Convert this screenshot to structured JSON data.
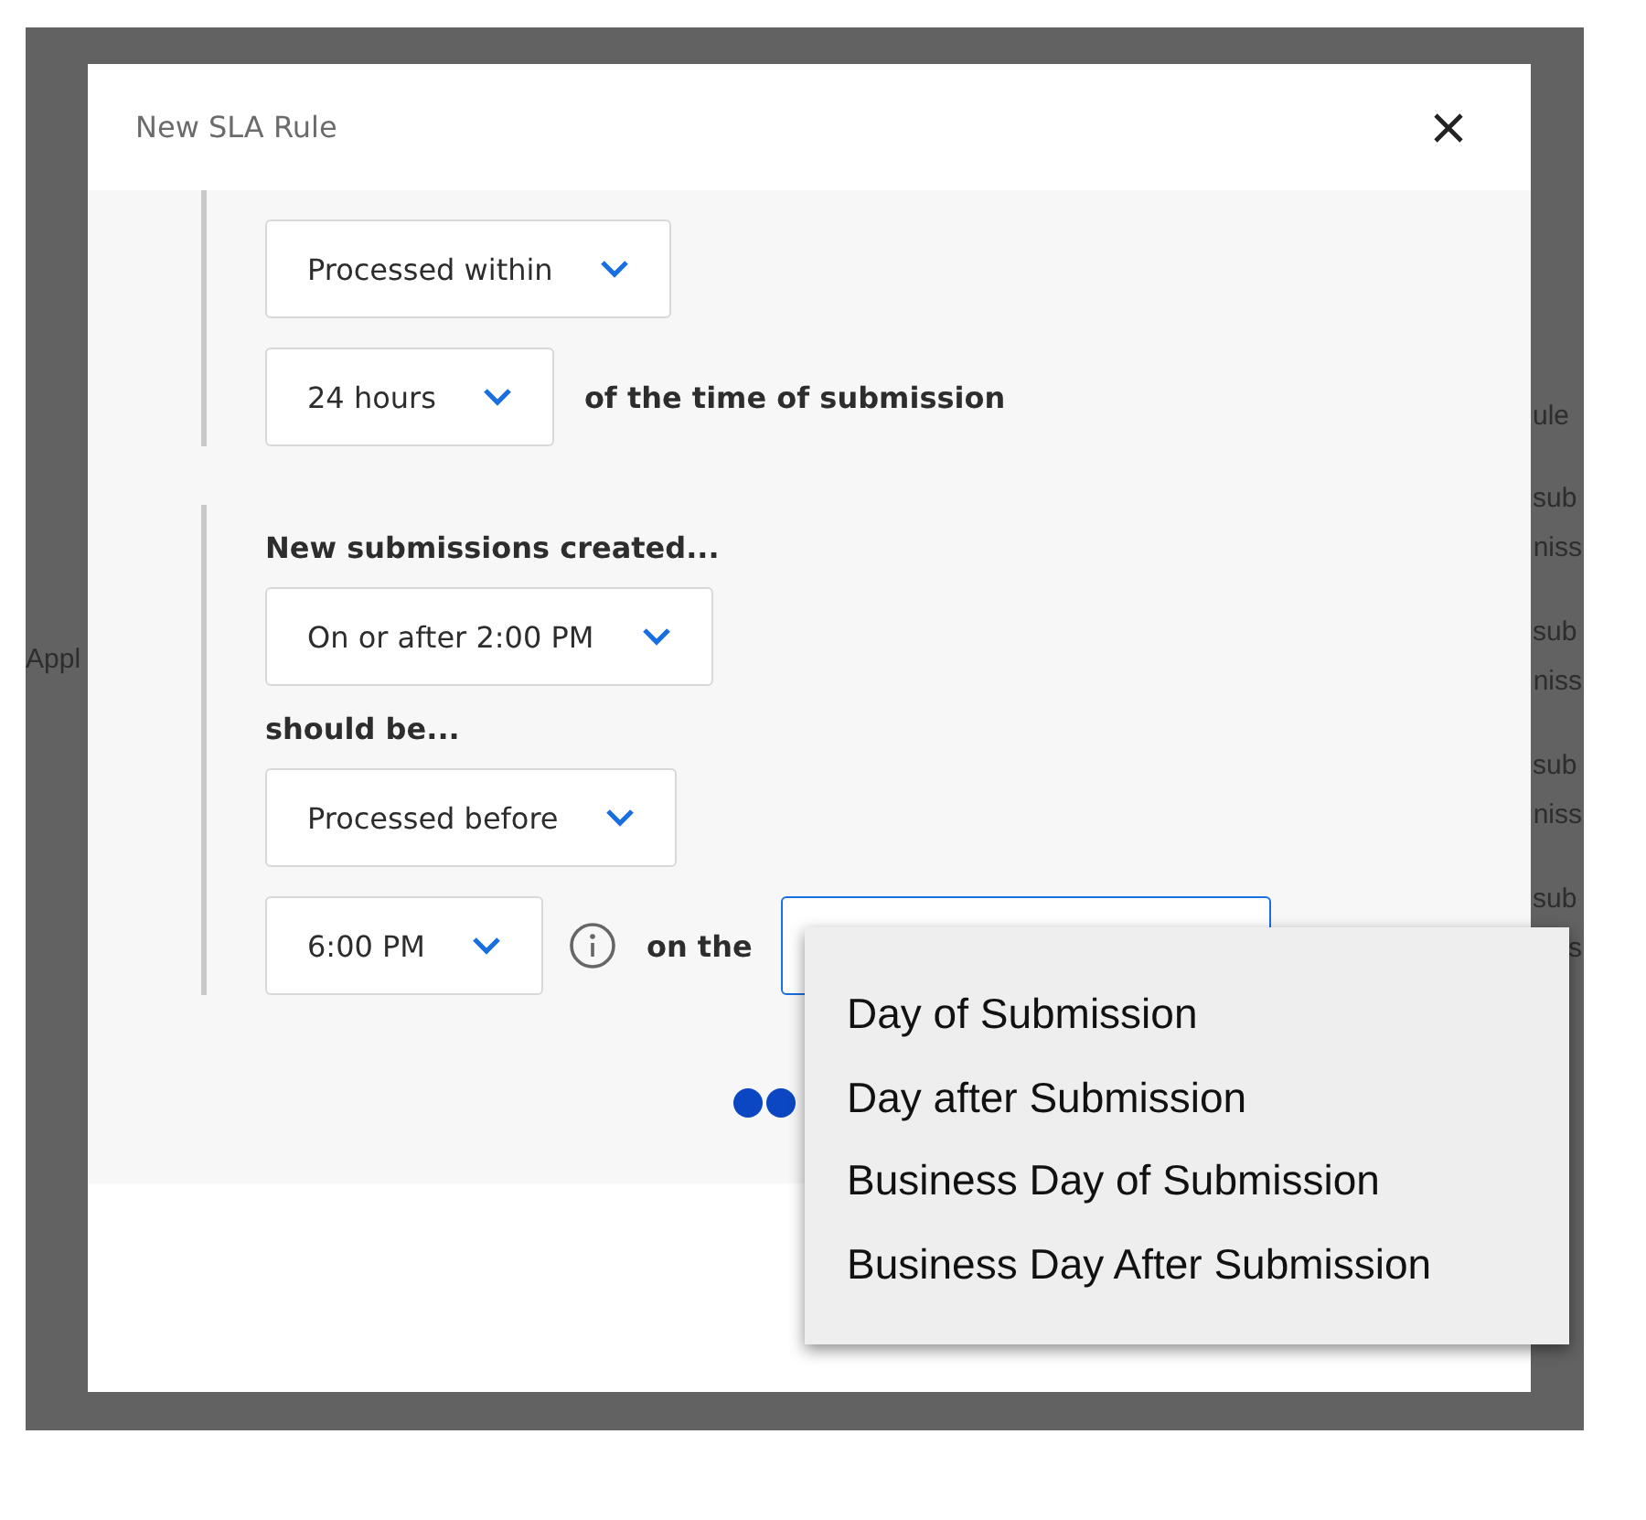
{
  "background": {
    "left_text": "Appl",
    "column_header": "ule",
    "column_cells": [
      {
        "lines": [
          "sub",
          "niss"
        ]
      },
      {
        "lines": [
          "sub",
          "niss"
        ]
      },
      {
        "lines": [
          "sub",
          "niss"
        ]
      },
      {
        "lines": [
          "sub",
          "s"
        ]
      }
    ]
  },
  "window": {
    "title": "New SLA Rule"
  },
  "rule_groups": [
    {
      "rows": [
        {
          "kind": "select",
          "value": "Processed within"
        },
        {
          "kind": "select",
          "value": "24 hours",
          "after": "of the time of submission"
        }
      ]
    },
    {
      "rows": [
        {
          "kind": "label",
          "text": "New submissions created..."
        },
        {
          "kind": "select",
          "value": "On or after 2:00 PM"
        },
        {
          "kind": "label",
          "text": "should be..."
        },
        {
          "kind": "select",
          "value": "Processed before"
        },
        {
          "kind": "select_info",
          "value": "6:00 PM",
          "after": "on the",
          "open_select": true
        }
      ]
    }
  ],
  "dropdown_menu": {
    "options": [
      "Day of Submission",
      "Day after Submission",
      "Business Day of Submission",
      "Business Day After Submission"
    ]
  }
}
